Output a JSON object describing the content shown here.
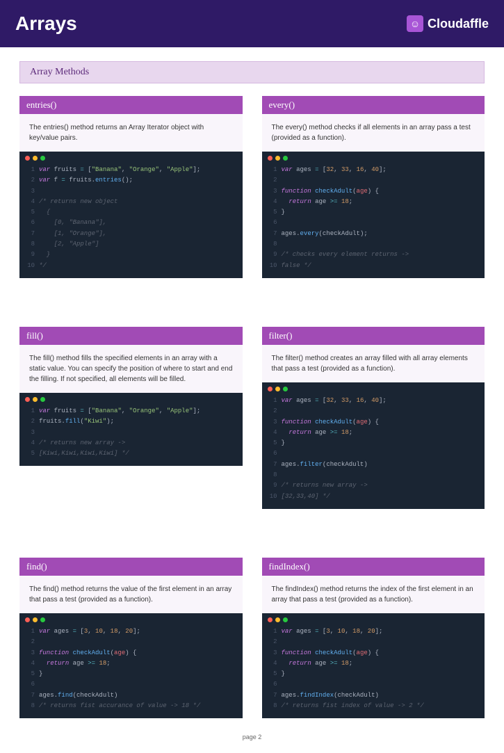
{
  "header": {
    "title": "Arrays",
    "brand": "Cloudaffle"
  },
  "section": "Array Methods",
  "footer": "page 2",
  "cards": [
    {
      "title": "entries()",
      "desc": "The entries() method returns an Array Iterator object with key/value pairs.",
      "code": [
        [
          {
            "t": "kw",
            "v": "var"
          },
          {
            "t": "pl",
            "v": " fruits "
          },
          {
            "t": "op",
            "v": "="
          },
          {
            "t": "pl",
            "v": " ["
          },
          {
            "t": "str",
            "v": "\"Banana\""
          },
          {
            "t": "pl",
            "v": ", "
          },
          {
            "t": "str",
            "v": "\"Orange\""
          },
          {
            "t": "pl",
            "v": ", "
          },
          {
            "t": "str",
            "v": "\"Apple\""
          },
          {
            "t": "pl",
            "v": "];"
          }
        ],
        [
          {
            "t": "kw",
            "v": "var"
          },
          {
            "t": "pl",
            "v": " f "
          },
          {
            "t": "op",
            "v": "="
          },
          {
            "t": "pl",
            "v": " fruits."
          },
          {
            "t": "fn",
            "v": "entries"
          },
          {
            "t": "pl",
            "v": "();"
          }
        ],
        [],
        [
          {
            "t": "cm",
            "v": "/* returns new object"
          }
        ],
        [
          {
            "t": "cm",
            "v": "  {"
          }
        ],
        [
          {
            "t": "cm",
            "v": "    [0, \"Banana\"],"
          }
        ],
        [
          {
            "t": "cm",
            "v": "    [1, \"Orange\"],"
          }
        ],
        [
          {
            "t": "cm",
            "v": "    [2, \"Apple\"]"
          }
        ],
        [
          {
            "t": "cm",
            "v": "  }"
          }
        ],
        [
          {
            "t": "cm",
            "v": "*/"
          }
        ]
      ]
    },
    {
      "title": "every()",
      "desc": "The every() method checks if all elements in an array pass a test (provided as a function).",
      "code": [
        [
          {
            "t": "kw",
            "v": "var"
          },
          {
            "t": "pl",
            "v": " ages "
          },
          {
            "t": "op",
            "v": "="
          },
          {
            "t": "pl",
            "v": " ["
          },
          {
            "t": "num",
            "v": "32"
          },
          {
            "t": "pl",
            "v": ", "
          },
          {
            "t": "num",
            "v": "33"
          },
          {
            "t": "pl",
            "v": ", "
          },
          {
            "t": "num",
            "v": "16"
          },
          {
            "t": "pl",
            "v": ", "
          },
          {
            "t": "num",
            "v": "40"
          },
          {
            "t": "pl",
            "v": "];"
          }
        ],
        [],
        [
          {
            "t": "kw",
            "v": "function"
          },
          {
            "t": "pl",
            "v": " "
          },
          {
            "t": "fn",
            "v": "checkAdult"
          },
          {
            "t": "pl",
            "v": "("
          },
          {
            "t": "id",
            "v": "age"
          },
          {
            "t": "pl",
            "v": ") {"
          }
        ],
        [
          {
            "t": "pl",
            "v": "  "
          },
          {
            "t": "kw",
            "v": "return"
          },
          {
            "t": "pl",
            "v": " age "
          },
          {
            "t": "op",
            "v": ">="
          },
          {
            "t": "pl",
            "v": " "
          },
          {
            "t": "num",
            "v": "18"
          },
          {
            "t": "pl",
            "v": ";"
          }
        ],
        [
          {
            "t": "pl",
            "v": "}"
          }
        ],
        [],
        [
          {
            "t": "pl",
            "v": "ages."
          },
          {
            "t": "fn",
            "v": "every"
          },
          {
            "t": "pl",
            "v": "(checkAdult);"
          }
        ],
        [],
        [
          {
            "t": "cm",
            "v": "/* checks every element returns ->"
          }
        ],
        [
          {
            "t": "cm",
            "v": "false */"
          }
        ]
      ]
    },
    {
      "title": "fill()",
      "desc": "The fill() method fills the specified elements in an array with a static value. You can specify the position of where to start and end the filling. If not specified, all elements will be filled.",
      "code": [
        [
          {
            "t": "kw",
            "v": "var"
          },
          {
            "t": "pl",
            "v": " fruits "
          },
          {
            "t": "op",
            "v": "="
          },
          {
            "t": "pl",
            "v": " ["
          },
          {
            "t": "str",
            "v": "\"Banana\""
          },
          {
            "t": "pl",
            "v": ", "
          },
          {
            "t": "str",
            "v": "\"Orange\""
          },
          {
            "t": "pl",
            "v": ", "
          },
          {
            "t": "str",
            "v": "\"Apple\""
          },
          {
            "t": "pl",
            "v": "];"
          }
        ],
        [
          {
            "t": "pl",
            "v": "fruits."
          },
          {
            "t": "fn",
            "v": "fill"
          },
          {
            "t": "pl",
            "v": "("
          },
          {
            "t": "str",
            "v": "\"Kiwi\""
          },
          {
            "t": "pl",
            "v": ");"
          }
        ],
        [],
        [
          {
            "t": "cm",
            "v": "/* returns new array ->"
          }
        ],
        [
          {
            "t": "cm",
            "v": "[Kiwi,Kiwi,Kiwi,Kiwi] */"
          }
        ]
      ]
    },
    {
      "title": "filter()",
      "desc": "The filter() method creates an array filled with all array elements that pass a test (provided as a function).",
      "code": [
        [
          {
            "t": "kw",
            "v": "var"
          },
          {
            "t": "pl",
            "v": " ages "
          },
          {
            "t": "op",
            "v": "="
          },
          {
            "t": "pl",
            "v": " ["
          },
          {
            "t": "num",
            "v": "32"
          },
          {
            "t": "pl",
            "v": ", "
          },
          {
            "t": "num",
            "v": "33"
          },
          {
            "t": "pl",
            "v": ", "
          },
          {
            "t": "num",
            "v": "16"
          },
          {
            "t": "pl",
            "v": ", "
          },
          {
            "t": "num",
            "v": "40"
          },
          {
            "t": "pl",
            "v": "];"
          }
        ],
        [],
        [
          {
            "t": "kw",
            "v": "function"
          },
          {
            "t": "pl",
            "v": " "
          },
          {
            "t": "fn",
            "v": "checkAdult"
          },
          {
            "t": "pl",
            "v": "("
          },
          {
            "t": "id",
            "v": "age"
          },
          {
            "t": "pl",
            "v": ") {"
          }
        ],
        [
          {
            "t": "pl",
            "v": "  "
          },
          {
            "t": "kw",
            "v": "return"
          },
          {
            "t": "pl",
            "v": " age "
          },
          {
            "t": "op",
            "v": ">="
          },
          {
            "t": "pl",
            "v": " "
          },
          {
            "t": "num",
            "v": "18"
          },
          {
            "t": "pl",
            "v": ";"
          }
        ],
        [
          {
            "t": "pl",
            "v": "}"
          }
        ],
        [],
        [
          {
            "t": "pl",
            "v": "ages."
          },
          {
            "t": "fn",
            "v": "filter"
          },
          {
            "t": "pl",
            "v": "(checkAdult)"
          }
        ],
        [],
        [
          {
            "t": "cm",
            "v": "/* returns new array ->"
          }
        ],
        [
          {
            "t": "cm",
            "v": "[32,33,40] */"
          }
        ]
      ]
    },
    {
      "title": "find()",
      "desc": "The find() method returns the value of the first element in an array that pass a test (provided as a function).",
      "code": [
        [
          {
            "t": "kw",
            "v": "var"
          },
          {
            "t": "pl",
            "v": " ages "
          },
          {
            "t": "op",
            "v": "="
          },
          {
            "t": "pl",
            "v": " ["
          },
          {
            "t": "num",
            "v": "3"
          },
          {
            "t": "pl",
            "v": ", "
          },
          {
            "t": "num",
            "v": "10"
          },
          {
            "t": "pl",
            "v": ", "
          },
          {
            "t": "num",
            "v": "18"
          },
          {
            "t": "pl",
            "v": ", "
          },
          {
            "t": "num",
            "v": "20"
          },
          {
            "t": "pl",
            "v": "];"
          }
        ],
        [],
        [
          {
            "t": "kw",
            "v": "function"
          },
          {
            "t": "pl",
            "v": " "
          },
          {
            "t": "fn",
            "v": "checkAdult"
          },
          {
            "t": "pl",
            "v": "("
          },
          {
            "t": "id",
            "v": "age"
          },
          {
            "t": "pl",
            "v": ") {"
          }
        ],
        [
          {
            "t": "pl",
            "v": "  "
          },
          {
            "t": "kw",
            "v": "return"
          },
          {
            "t": "pl",
            "v": " age "
          },
          {
            "t": "op",
            "v": ">="
          },
          {
            "t": "pl",
            "v": " "
          },
          {
            "t": "num",
            "v": "18"
          },
          {
            "t": "pl",
            "v": ";"
          }
        ],
        [
          {
            "t": "pl",
            "v": "}"
          }
        ],
        [],
        [
          {
            "t": "pl",
            "v": "ages."
          },
          {
            "t": "fn",
            "v": "find"
          },
          {
            "t": "pl",
            "v": "(checkAdult)"
          }
        ],
        [
          {
            "t": "cm",
            "v": "/* returns fist accurance of value -> 18 */"
          }
        ]
      ]
    },
    {
      "title": "findIndex()",
      "desc": "The findIndex() method returns the index of the first element in an array that pass a test (provided as a function).",
      "code": [
        [
          {
            "t": "kw",
            "v": "var"
          },
          {
            "t": "pl",
            "v": " ages "
          },
          {
            "t": "op",
            "v": "="
          },
          {
            "t": "pl",
            "v": " ["
          },
          {
            "t": "num",
            "v": "3"
          },
          {
            "t": "pl",
            "v": ", "
          },
          {
            "t": "num",
            "v": "10"
          },
          {
            "t": "pl",
            "v": ", "
          },
          {
            "t": "num",
            "v": "18"
          },
          {
            "t": "pl",
            "v": ", "
          },
          {
            "t": "num",
            "v": "20"
          },
          {
            "t": "pl",
            "v": "];"
          }
        ],
        [],
        [
          {
            "t": "kw",
            "v": "function"
          },
          {
            "t": "pl",
            "v": " "
          },
          {
            "t": "fn",
            "v": "checkAdult"
          },
          {
            "t": "pl",
            "v": "("
          },
          {
            "t": "id",
            "v": "age"
          },
          {
            "t": "pl",
            "v": ") {"
          }
        ],
        [
          {
            "t": "pl",
            "v": "  "
          },
          {
            "t": "kw",
            "v": "return"
          },
          {
            "t": "pl",
            "v": " age "
          },
          {
            "t": "op",
            "v": ">="
          },
          {
            "t": "pl",
            "v": " "
          },
          {
            "t": "num",
            "v": "18"
          },
          {
            "t": "pl",
            "v": ";"
          }
        ],
        [
          {
            "t": "pl",
            "v": "}"
          }
        ],
        [],
        [
          {
            "t": "pl",
            "v": "ages."
          },
          {
            "t": "fn",
            "v": "findIndex"
          },
          {
            "t": "pl",
            "v": "(checkAdult)"
          }
        ],
        [
          {
            "t": "cm",
            "v": "/* returns fist index of value -> 2 */"
          }
        ]
      ]
    }
  ]
}
